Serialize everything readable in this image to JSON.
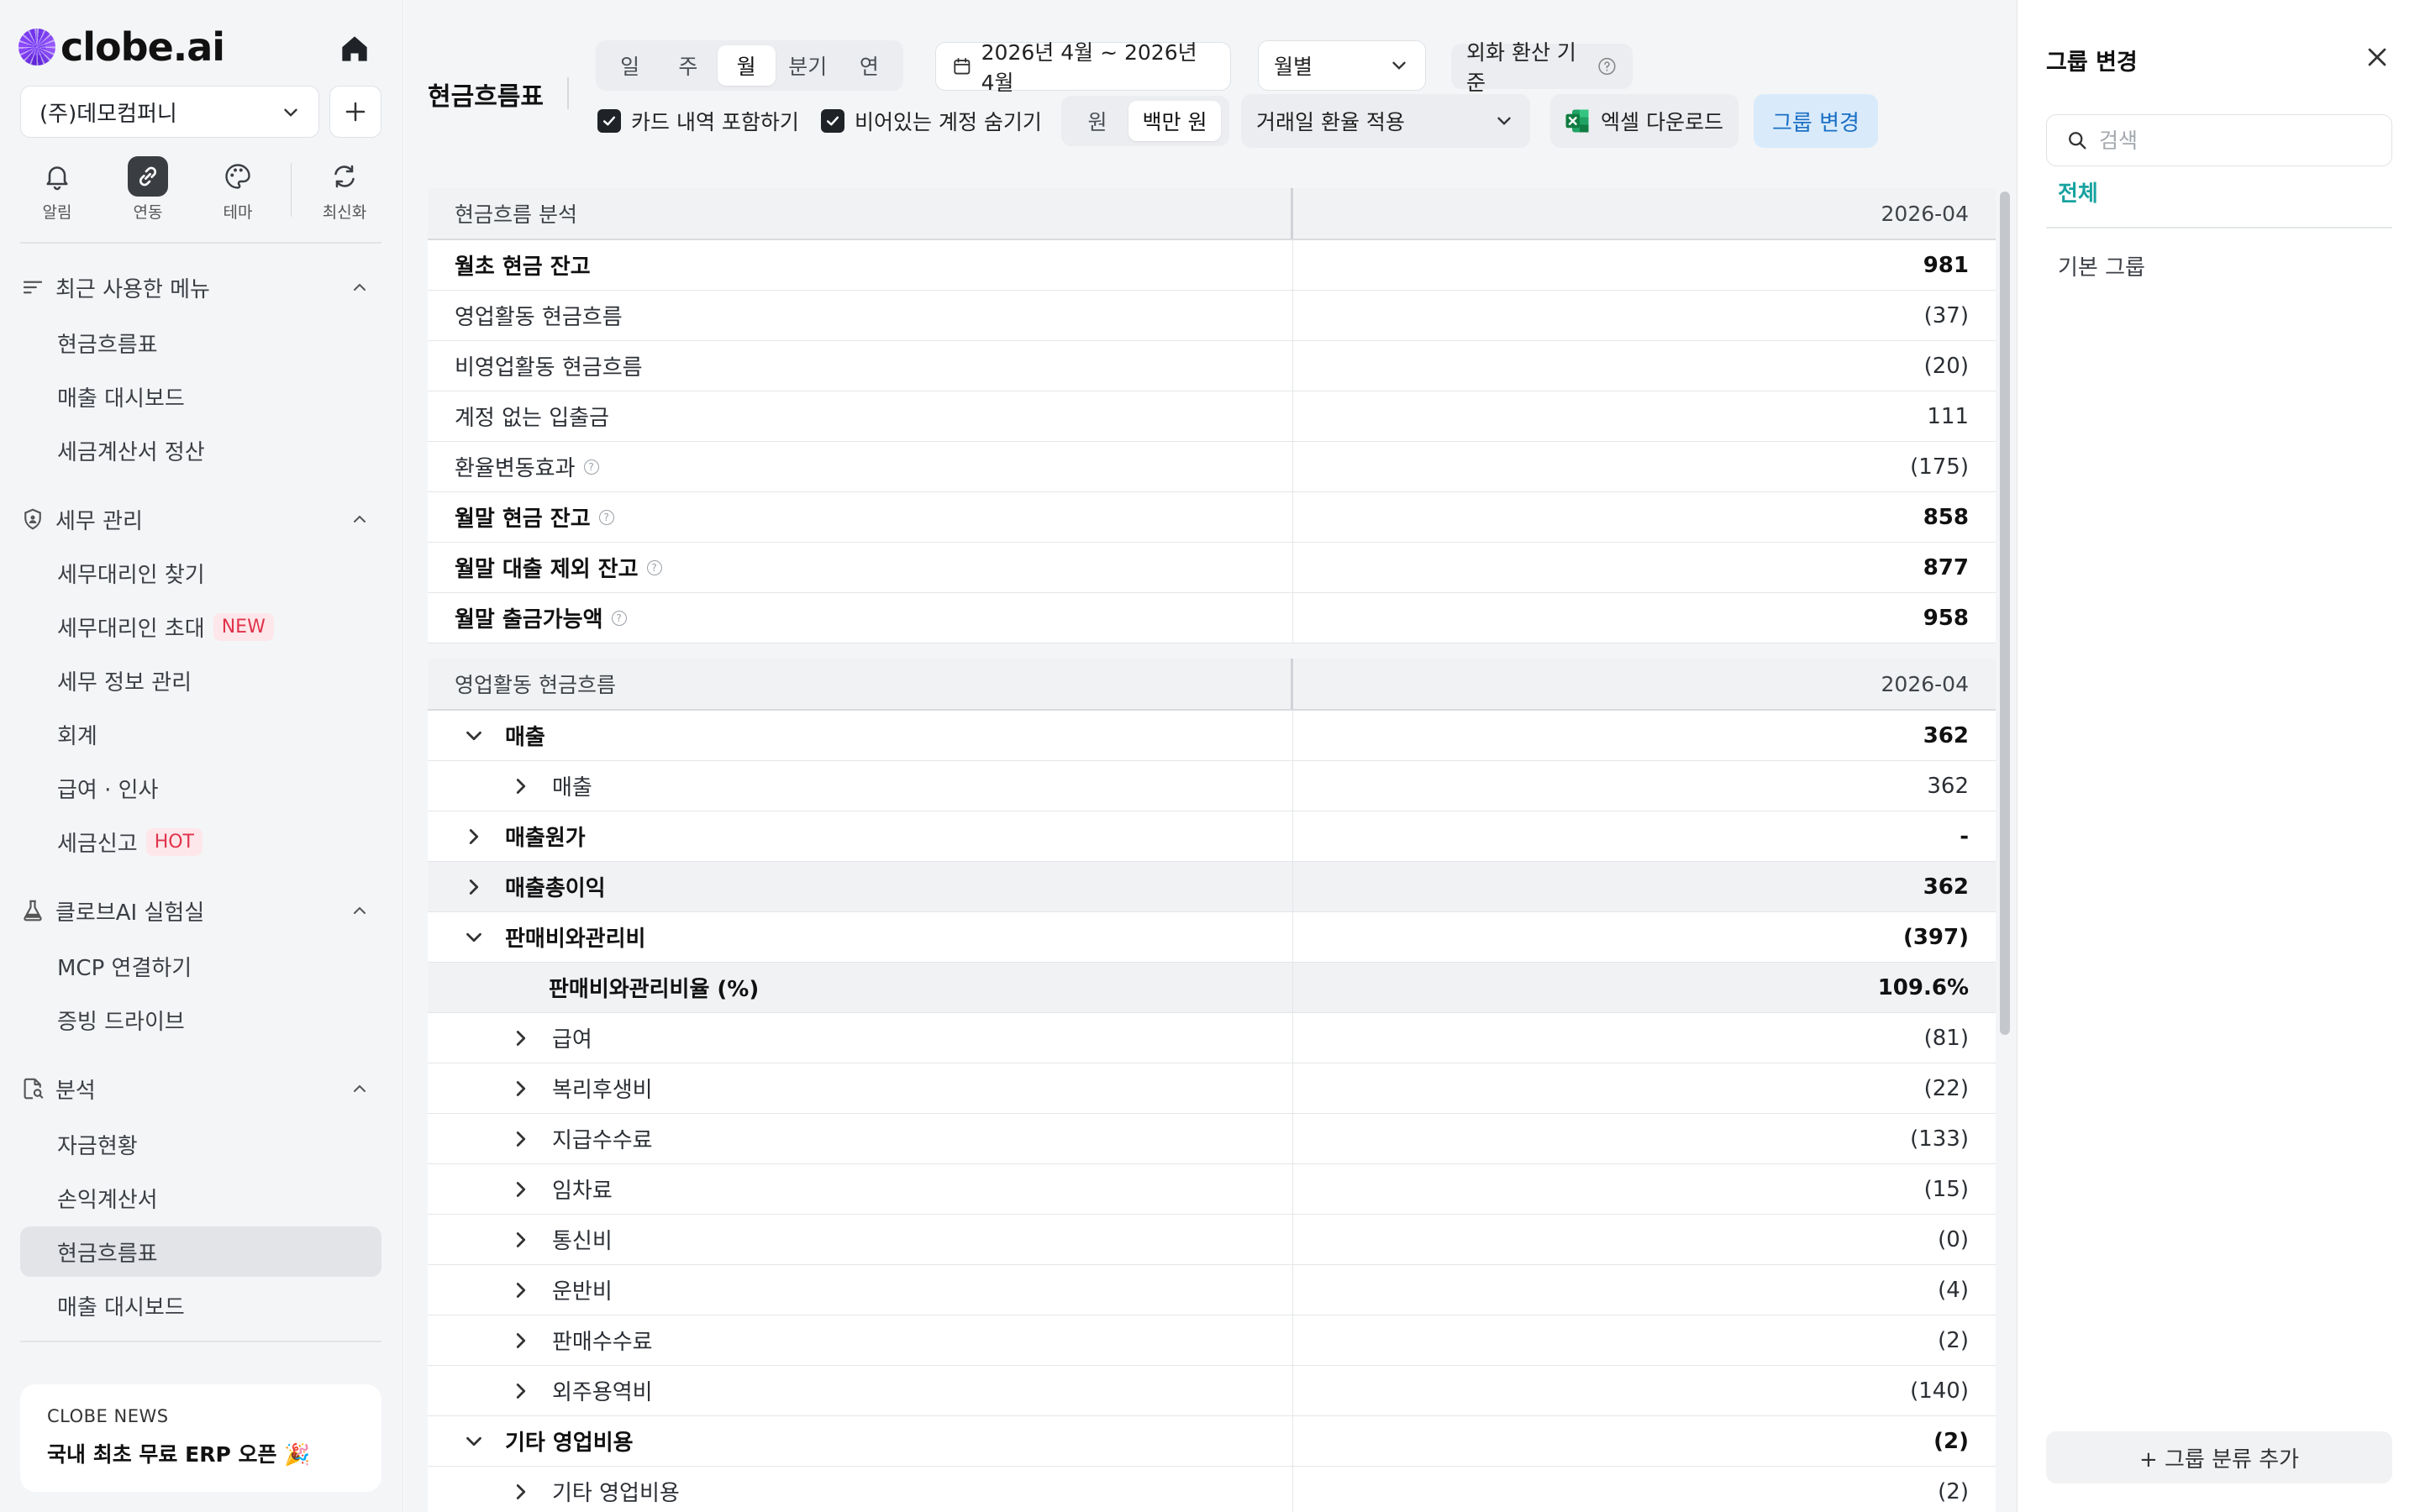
{
  "brand": {
    "name": "clobe.ai"
  },
  "company": {
    "name": "(주)데모컴퍼니"
  },
  "quick_actions": [
    {
      "label": "알림",
      "icon": "bell-icon"
    },
    {
      "label": "연동",
      "icon": "link-icon"
    },
    {
      "label": "테마",
      "icon": "palette-icon"
    },
    {
      "label": "최신화",
      "icon": "refresh-icon"
    }
  ],
  "sidebar": {
    "recent": {
      "title": "최근 사용한 메뉴",
      "items": [
        "현금흐름표",
        "매출 대시보드",
        "세금계산서 정산"
      ]
    },
    "tax": {
      "title": "세무 관리",
      "items": [
        "세무대리인 찾기",
        "세무대리인 초대",
        "세무 정보 관리",
        "회계",
        "급여 · 인사",
        "세금신고"
      ]
    },
    "badges": {
      "new": "NEW",
      "hot": "HOT"
    },
    "lab": {
      "title": "클로브AI 실험실",
      "items": [
        "MCP 연결하기",
        "증빙 드라이브"
      ]
    },
    "analysis": {
      "title": "분석",
      "items": [
        "자금현황",
        "손익계산서",
        "현금흐름표",
        "매출 대시보드"
      ]
    },
    "news": {
      "tag": "CLOBE NEWS",
      "text": "국내 최초 무료 ERP 오픈 🎉"
    }
  },
  "toolbar": {
    "page_title": "현금흐름표",
    "period_options": [
      "일",
      "주",
      "월",
      "분기",
      "연"
    ],
    "period_selected": "월",
    "date_range": "2026년 4월 ~ 2026년 4월",
    "view_mode": "월별",
    "fx_basis_label": "외화 환산 기준",
    "include_cards": "카드 내역 포함하기",
    "hide_empty": "비어있는 계정 숨기기",
    "unit_options": [
      "원",
      "백만 원"
    ],
    "unit_selected": "백만 원",
    "fx_rate_mode": "거래일 환율 적용",
    "excel_button": "엑셀 다운로드",
    "group_button": "그룹 변경"
  },
  "summary_table": {
    "header": {
      "label": "현금흐름 분석",
      "period": "2026-04"
    },
    "rows": [
      {
        "label": "월초 현금 잔고",
        "value": "981",
        "bold": true,
        "info": false
      },
      {
        "label": "영업활동 현금흐름",
        "value": "(37)",
        "bold": false,
        "info": false
      },
      {
        "label": "비영업활동 현금흐름",
        "value": "(20)",
        "bold": false,
        "info": false
      },
      {
        "label": "계정 없는 입출금",
        "value": "111",
        "bold": false,
        "info": false
      },
      {
        "label": "환율변동효과",
        "value": "(175)",
        "bold": false,
        "info": true
      },
      {
        "label": "월말 현금 잔고",
        "value": "858",
        "bold": true,
        "info": true
      },
      {
        "label": "월말 대출 제외 잔고",
        "value": "877",
        "bold": true,
        "info": true
      },
      {
        "label": "월말 출금가능액",
        "value": "958",
        "bold": true,
        "info": true
      }
    ]
  },
  "operating_table": {
    "header": {
      "label": "영업활동 현금흐름",
      "period": "2026-04"
    },
    "rows": [
      {
        "label": "매출",
        "value": "362",
        "level": 1,
        "toggle": "down",
        "bold": true,
        "shade": false
      },
      {
        "label": "매출",
        "value": "362",
        "level": 2,
        "toggle": "right",
        "bold": false,
        "shade": false
      },
      {
        "label": "매출원가",
        "value": "-",
        "level": 1,
        "toggle": "right",
        "bold": true,
        "shade": false
      },
      {
        "label": "매출총이익",
        "value": "362",
        "level": 1,
        "toggle": "right",
        "bold": true,
        "shade": true
      },
      {
        "label": "판매비와관리비",
        "value": "(397)",
        "level": 1,
        "toggle": "down",
        "bold": true,
        "shade": false
      },
      {
        "label": "판매비와관리비율 (%)",
        "value": "109.6%",
        "level": 3,
        "toggle": "none",
        "bold": true,
        "shade": true
      },
      {
        "label": "급여",
        "value": "(81)",
        "level": 2,
        "toggle": "right",
        "bold": false,
        "shade": false
      },
      {
        "label": "복리후생비",
        "value": "(22)",
        "level": 2,
        "toggle": "right",
        "bold": false,
        "shade": false
      },
      {
        "label": "지급수수료",
        "value": "(133)",
        "level": 2,
        "toggle": "right",
        "bold": false,
        "shade": false
      },
      {
        "label": "임차료",
        "value": "(15)",
        "level": 2,
        "toggle": "right",
        "bold": false,
        "shade": false
      },
      {
        "label": "통신비",
        "value": "(0)",
        "level": 2,
        "toggle": "right",
        "bold": false,
        "shade": false
      },
      {
        "label": "운반비",
        "value": "(4)",
        "level": 2,
        "toggle": "right",
        "bold": false,
        "shade": false
      },
      {
        "label": "판매수수료",
        "value": "(2)",
        "level": 2,
        "toggle": "right",
        "bold": false,
        "shade": false
      },
      {
        "label": "외주용역비",
        "value": "(140)",
        "level": 2,
        "toggle": "right",
        "bold": false,
        "shade": false
      },
      {
        "label": "기타 영업비용",
        "value": "(2)",
        "level": 1,
        "toggle": "down",
        "bold": true,
        "shade": false
      },
      {
        "label": "기타 영업비용",
        "value": "(2)",
        "level": 2,
        "toggle": "right",
        "bold": false,
        "shade": false
      }
    ]
  },
  "group_panel": {
    "title": "그룹 변경",
    "search_placeholder": "검색",
    "tab_all": "전체",
    "items": [
      "기본 그룹"
    ],
    "add_button": "+ 그룹 분류 추가"
  }
}
